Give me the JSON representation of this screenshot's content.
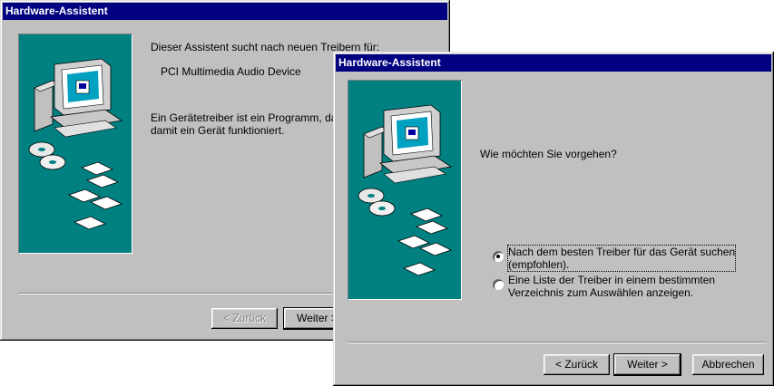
{
  "back_window": {
    "title": "Hardware-Assistent",
    "line1": "Dieser Assistent sucht nach neuen Treibern für:",
    "device": "PCI Multimedia Audio Device",
    "desc_line1": "Ein Gerätetreiber ist ein Programm, das ein",
    "desc_line2": "damit ein Gerät funktioniert.",
    "back_button": "< Zurück",
    "next_button": "Weiter >"
  },
  "front_window": {
    "title": "Hardware-Assistent",
    "question": "Wie möchten Sie vorgehen?",
    "option1_line1": "Nach dem besten Treiber für das Gerät suchen",
    "option1_line2": "(empfohlen).",
    "option2_line1": "Eine Liste der Treiber in einem bestimmten",
    "option2_line2": "Verzeichnis zum Auswählen anzeigen.",
    "selected_option": 1,
    "back_button": "< Zurück",
    "next_button": "Weiter >",
    "cancel_button": "Abbrechen"
  },
  "colors": {
    "titlebar": "#000080",
    "panel": "#008080",
    "face": "#c0c0c0"
  },
  "icons": {
    "illustration": "computer-with-cds-and-floppies-illustration"
  }
}
